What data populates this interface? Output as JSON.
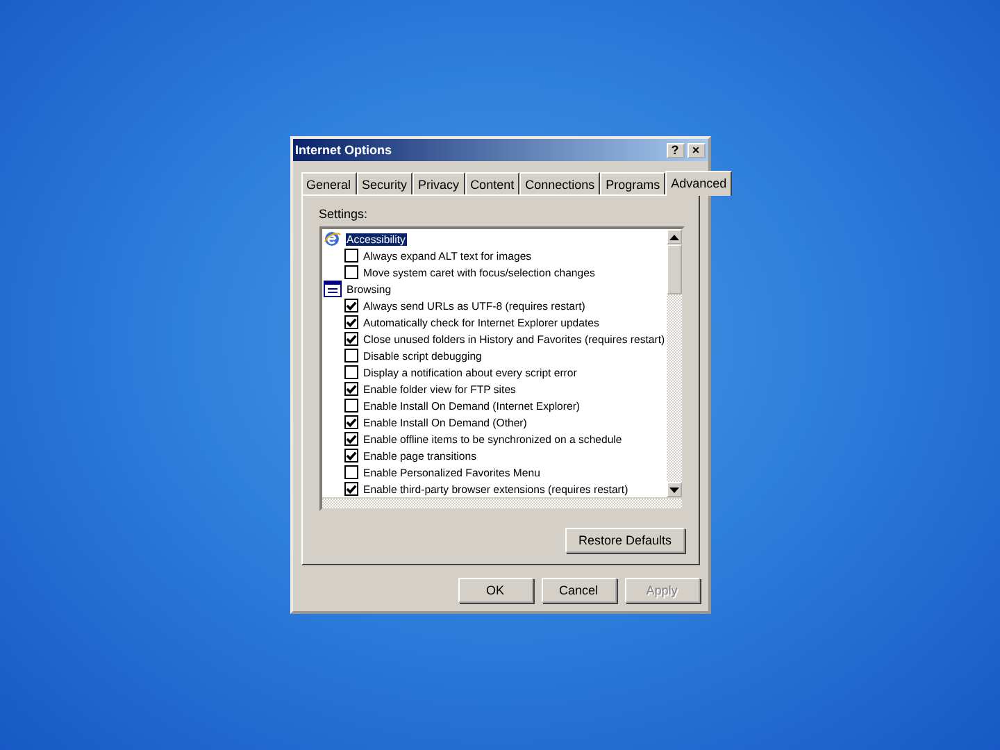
{
  "window": {
    "title": "Internet Options",
    "help_button": "?",
    "close_button": "×"
  },
  "tabs": [
    {
      "label": "General",
      "selected": false
    },
    {
      "label": "Security",
      "selected": false
    },
    {
      "label": "Privacy",
      "selected": false
    },
    {
      "label": "Content",
      "selected": false
    },
    {
      "label": "Connections",
      "selected": false
    },
    {
      "label": "Programs",
      "selected": false
    },
    {
      "label": "Advanced",
      "selected": true
    }
  ],
  "settings_label": "Settings:",
  "settings": [
    {
      "kind": "category",
      "label": "Accessibility",
      "selected": true
    },
    {
      "kind": "checkbox",
      "label": "Always expand ALT text for images",
      "checked": false,
      "selected": false
    },
    {
      "kind": "checkbox",
      "label": "Move system caret with focus/selection changes",
      "checked": false,
      "selected": false
    },
    {
      "kind": "category",
      "label": "Browsing",
      "selected": false
    },
    {
      "kind": "checkbox",
      "label": "Always send URLs as UTF-8 (requires restart)",
      "checked": true,
      "selected": false
    },
    {
      "kind": "checkbox",
      "label": "Automatically check for Internet Explorer updates",
      "checked": true,
      "selected": false
    },
    {
      "kind": "checkbox",
      "label": "Close unused folders in History and Favorites (requires restart)",
      "checked": true,
      "selected": false
    },
    {
      "kind": "checkbox",
      "label": "Disable script debugging",
      "checked": false,
      "selected": false
    },
    {
      "kind": "checkbox",
      "label": "Display a notification about every script error",
      "checked": false,
      "selected": false
    },
    {
      "kind": "checkbox",
      "label": "Enable folder view for FTP sites",
      "checked": true,
      "selected": false
    },
    {
      "kind": "checkbox",
      "label": "Enable Install On Demand (Internet Explorer)",
      "checked": false,
      "selected": false
    },
    {
      "kind": "checkbox",
      "label": "Enable Install On Demand (Other)",
      "checked": true,
      "selected": false
    },
    {
      "kind": "checkbox",
      "label": "Enable offline items to be synchronized on a schedule",
      "checked": true,
      "selected": false
    },
    {
      "kind": "checkbox",
      "label": "Enable page transitions",
      "checked": true,
      "selected": false
    },
    {
      "kind": "checkbox",
      "label": "Enable Personalized Favorites Menu",
      "checked": false,
      "selected": false
    },
    {
      "kind": "checkbox",
      "label": "Enable third-party browser extensions (requires restart)",
      "checked": true,
      "selected": false
    }
  ],
  "restore_button": "Restore Defaults",
  "buttons": [
    {
      "label": "OK",
      "disabled": false
    },
    {
      "label": "Cancel",
      "disabled": false
    },
    {
      "label": "Apply",
      "disabled": true
    }
  ]
}
